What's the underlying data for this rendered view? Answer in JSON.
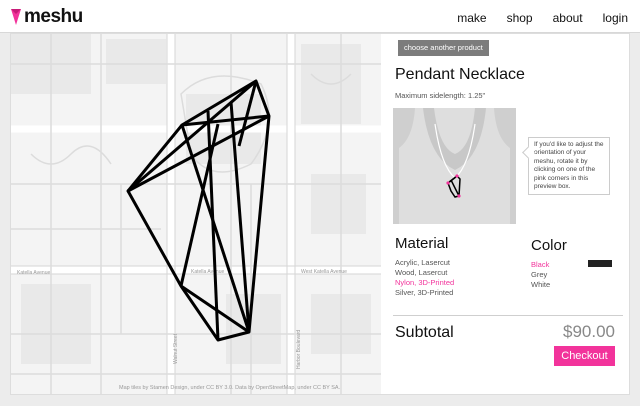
{
  "header": {
    "logo_text": "meshu",
    "nav": [
      "make",
      "shop",
      "about",
      "login"
    ]
  },
  "map": {
    "street_labels": [
      "Katella Avenue",
      "Katella Avenue",
      "West Katella Avenue",
      "Harbor Boulevard",
      "Walnut Street"
    ],
    "attribution": "Map tiles by Stamen Design, under CC BY 3.0. Data by OpenStreetMap, under CC BY SA."
  },
  "product": {
    "choose_button": "choose another product",
    "title": "Pendant Necklace",
    "subtitle": "Maximum sidelength: 1.25\"",
    "tooltip": "If you'd like to adjust the orientation of your meshu, rotate it by clicking on one of the pink corners in this preview box."
  },
  "material": {
    "heading": "Material",
    "options": [
      "Acrylic, Lasercut",
      "Wood, Lasercut",
      "Nylon, 3D-Printed",
      "Silver, 3D-Printed"
    ],
    "selected": "Nylon, 3D-Printed"
  },
  "color": {
    "heading": "Color",
    "options": [
      "Black",
      "Grey",
      "White"
    ],
    "selected": "Black",
    "swatch_hex": "#222222"
  },
  "checkout": {
    "subtotal_label": "Subtotal",
    "price": "$90.00",
    "button": "Checkout"
  },
  "colors": {
    "accent": "#f2339b",
    "button_grey": "#7c7c7c",
    "preview_bg": "#cfcfcf"
  }
}
